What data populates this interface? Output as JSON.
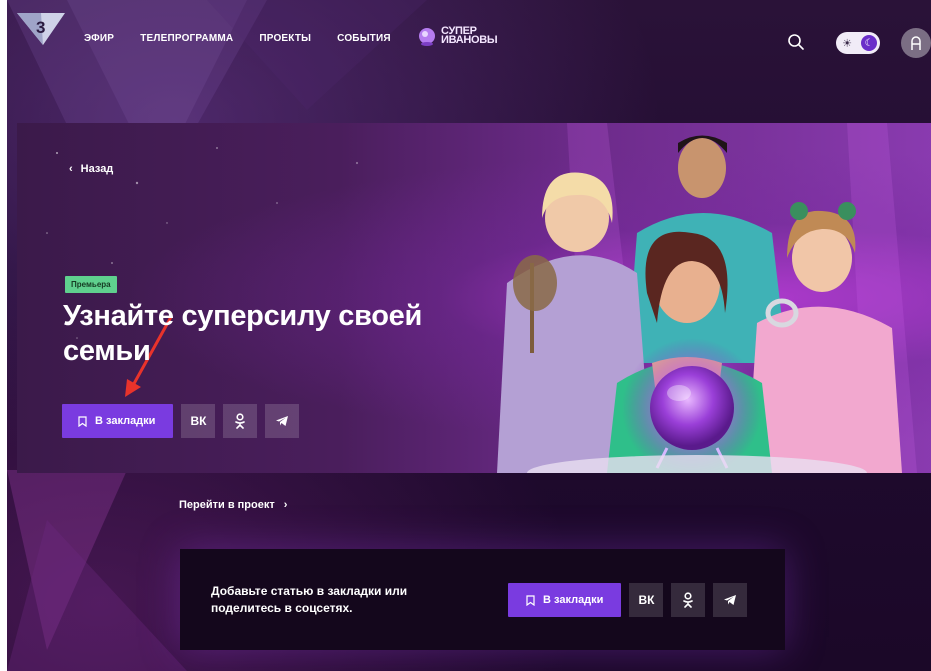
{
  "header": {
    "logo_text": "3",
    "nav": [
      {
        "label": "ЭФИР"
      },
      {
        "label": "ТЕЛЕПРОГРАММА"
      },
      {
        "label": "ПРОЕКТЫ"
      },
      {
        "label": "СОБЫТИЯ"
      }
    ],
    "brand": {
      "line1": "СУПЕР",
      "line2": "ИВАНОВЫ"
    },
    "search_icon": "search-icon",
    "theme_toggle": {
      "sun_icon": "sun-icon",
      "moon_icon": "moon-icon",
      "state": "dark"
    },
    "user_icon": "user-icon"
  },
  "hero": {
    "back_label": "Назад",
    "badge": "Премьера",
    "title": "Узнайте суперсилу своей семьи",
    "bookmark_label": "В закладки",
    "social": [
      {
        "name": "vk-icon",
        "glyph": "ВК"
      },
      {
        "name": "odnoklassniki-icon",
        "glyph": "ok"
      },
      {
        "name": "telegram-icon",
        "glyph": "tg"
      }
    ],
    "annotation_arrow_color": "#e8332b"
  },
  "project_link": {
    "label": "Перейти в проект"
  },
  "share_box": {
    "text": "Добавьте статью в закладки или поделитесь в соцсетях.",
    "bookmark_label": "В закладки"
  },
  "colors": {
    "accent": "#7a3be0",
    "badge_bg": "#5fd08e",
    "page_bg": "#200b30"
  }
}
